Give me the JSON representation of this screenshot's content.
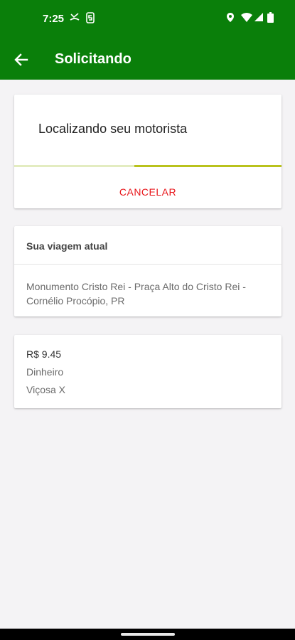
{
  "status_bar": {
    "time": "7:25",
    "icons": [
      "missed-call-icon",
      "s-app-icon",
      "location-icon",
      "wifi-icon",
      "signal-icon",
      "battery-icon"
    ]
  },
  "app_bar": {
    "title": "Solicitando",
    "back_icon": "arrow-back-icon",
    "color": "#0a7f0a"
  },
  "search_card": {
    "message": "Localizando seu motorista",
    "progress": 0.55,
    "cancel_label": "CANCELAR",
    "cancel_color": "#e8161b",
    "progress_color": "#b9c21c"
  },
  "trip_card": {
    "title": "Sua viagem atual",
    "address": "Monumento Cristo Rei - Praça Alto do Cristo Rei - Cornélio Procópio, PR"
  },
  "details_card": {
    "fare": "R$ 9.45",
    "payment_method": "Dinheiro",
    "vehicle": "Viçosa X"
  }
}
